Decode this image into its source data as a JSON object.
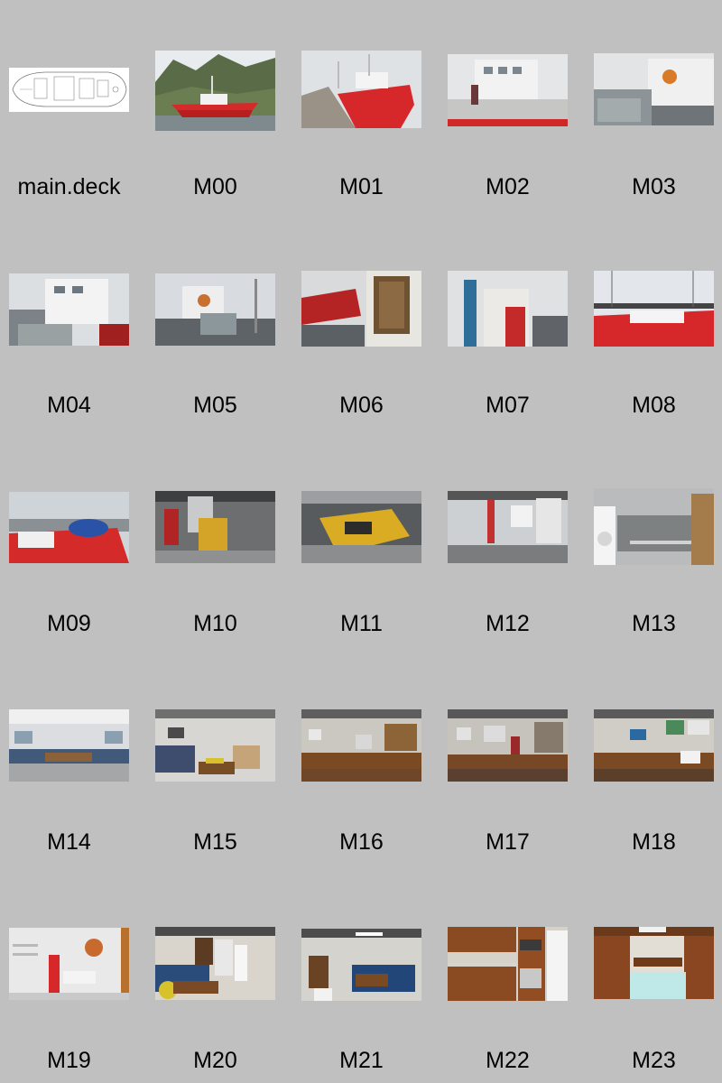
{
  "thumbnails": [
    {
      "label": "main.deck",
      "icon": "deck-plan-drawing"
    },
    {
      "label": "M00",
      "icon": "red-boat-mountains-photo"
    },
    {
      "label": "M01",
      "icon": "red-boat-pier-photo"
    },
    {
      "label": "M02",
      "icon": "boat-deck-person-photo"
    },
    {
      "label": "M03",
      "icon": "boat-deck-wheelhouse-photo"
    },
    {
      "label": "M04",
      "icon": "wheelhouse-side-photo"
    },
    {
      "label": "M05",
      "icon": "aft-deck-photo"
    },
    {
      "label": "M06",
      "icon": "deck-door-photo"
    },
    {
      "label": "M07",
      "icon": "deck-stairs-photo"
    },
    {
      "label": "M08",
      "icon": "red-deck-railing-photo"
    },
    {
      "label": "M09",
      "icon": "bow-deck-photo"
    },
    {
      "label": "M10",
      "icon": "engine-room-photo"
    },
    {
      "label": "M11",
      "icon": "yellow-engine-photo"
    },
    {
      "label": "M12",
      "icon": "engine-room-aft-photo"
    },
    {
      "label": "M13",
      "icon": "utility-room-photo"
    },
    {
      "label": "M14",
      "icon": "saloon-photo"
    },
    {
      "label": "M15",
      "icon": "lounge-photo"
    },
    {
      "label": "M16",
      "icon": "bridge-desk-photo"
    },
    {
      "label": "M17",
      "icon": "bridge-office-photo"
    },
    {
      "label": "M18",
      "icon": "navigation-station-photo"
    },
    {
      "label": "M19",
      "icon": "bathroom-photo"
    },
    {
      "label": "M20",
      "icon": "galley-dining-photo"
    },
    {
      "label": "M21",
      "icon": "mess-room-photo"
    },
    {
      "label": "M22",
      "icon": "galley-kitchen-photo"
    },
    {
      "label": "M23",
      "icon": "bunk-cabin-photo"
    }
  ],
  "colors": {
    "background": "#c0c0c0",
    "caption_text": "#000000"
  }
}
